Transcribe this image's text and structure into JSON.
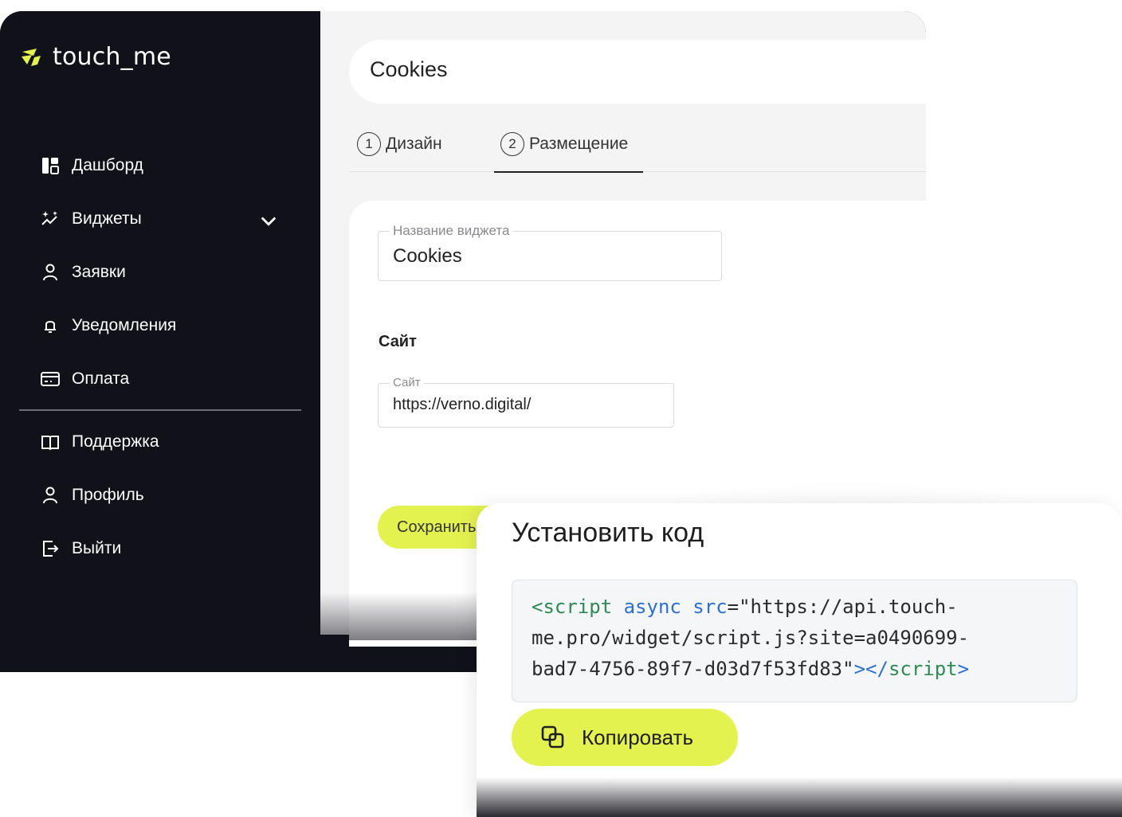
{
  "brand": {
    "name": "touch_me",
    "accent": "#e4f250",
    "sidebar_bg": "#111119"
  },
  "sidebar": {
    "items": [
      {
        "label": "Дашборд",
        "icon": "dashboard-icon"
      },
      {
        "label": "Виджеты",
        "icon": "widgets-sparkle-icon",
        "has_submenu": true
      },
      {
        "label": "Заявки",
        "icon": "user-icon"
      },
      {
        "label": "Уведомления",
        "icon": "bell-icon"
      },
      {
        "label": "Оплата",
        "icon": "credit-card-icon"
      },
      {
        "label": "Поддержка",
        "icon": "book-icon"
      },
      {
        "label": "Профиль",
        "icon": "user-icon"
      },
      {
        "label": "Выйти",
        "icon": "logout-icon"
      }
    ]
  },
  "header": {
    "title": "Cookies"
  },
  "tabs": [
    {
      "number": "1",
      "label": "Дизайн",
      "active": false
    },
    {
      "number": "2",
      "label": "Размещение",
      "active": true
    }
  ],
  "form": {
    "widget_name": {
      "label": "Название виджета",
      "value": "Cookies"
    },
    "site_section_title": "Сайт",
    "site": {
      "label": "Сайт",
      "value": "https://verno.digital/"
    },
    "save_label": "Сохранить"
  },
  "dialog": {
    "title": "Установить код",
    "code_lines": [
      {
        "tag_open": "<script",
        "attr1": " async",
        "attr2": " src",
        "rest": "=\"https://api.touch-"
      },
      {
        "text": "me.pro/widget/script.js?site=a0490699-"
      },
      {
        "text": "bad7-4756-89f7-d03d7f53fd83\"",
        "close_bracket": "></",
        "close_tag": "script",
        "end": ">"
      }
    ],
    "copy_label": "Копировать"
  }
}
